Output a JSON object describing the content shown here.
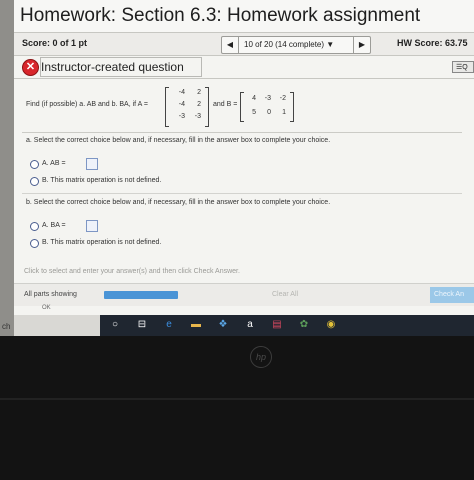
{
  "header": {
    "title": "Homework: Section 6.3: Homework assignment",
    "score": "Score: 0 of 1 pt",
    "nav_prev": "◀",
    "nav_label": "10 of 20 (14 complete) ▼",
    "nav_next": "▶",
    "hw_score": "HW Score: 63.75"
  },
  "question": {
    "title": "Instructor-created question",
    "x_icon": "✕",
    "menu_label": "Q",
    "menu_icon": "list-icon"
  },
  "problem": {
    "prefix": "Find (if possible) a. AB and b. BA, if A =",
    "and_b": "and B =",
    "matrix_a": [
      [
        "-4",
        "2"
      ],
      [
        "-4",
        "2"
      ],
      [
        "-3",
        "-3"
      ]
    ],
    "matrix_b": [
      [
        "4",
        "-3",
        "-2"
      ],
      [
        "5",
        "0",
        "1"
      ]
    ]
  },
  "part_a": {
    "question": "a. Select the correct choice below and, if necessary, fill in the answer box to complete your choice.",
    "choice_a": "A.  AB =",
    "choice_b": "B.  This matrix operation is not defined."
  },
  "part_b": {
    "question": "b. Select the correct choice below and, if necessary, fill in the answer box to complete your choice.",
    "choice_a": "A.  BA =",
    "choice_b": "B.  This matrix operation is not defined."
  },
  "footer": {
    "hint": "Click to select and enter your answer(s) and then click Check Answer.",
    "all_parts": "All parts showing",
    "clear_all": "Clear All",
    "check_answer": "Check An",
    "ok": "OK",
    "progress_fraction": 1.0
  },
  "side_strip_text": "ch",
  "taskbar": {
    "icons": [
      "start-icon",
      "task-view-icon",
      "edge-icon",
      "file-explorer-icon",
      "dropbox-icon",
      "amazon-icon",
      "store-icon",
      "photos-icon",
      "chrome-icon"
    ],
    "glyphs": [
      "○",
      "⊟",
      "e",
      "▬",
      "❖",
      "a",
      "▤",
      "✿",
      "◉"
    ],
    "colors": [
      "#ffffff",
      "#ffffff",
      "#3b8ee0",
      "#e8b64c",
      "#5aa7e8",
      "#ffffff",
      "#d84860",
      "#5c9e5a",
      "#e4c23a"
    ]
  },
  "brand": "hp"
}
